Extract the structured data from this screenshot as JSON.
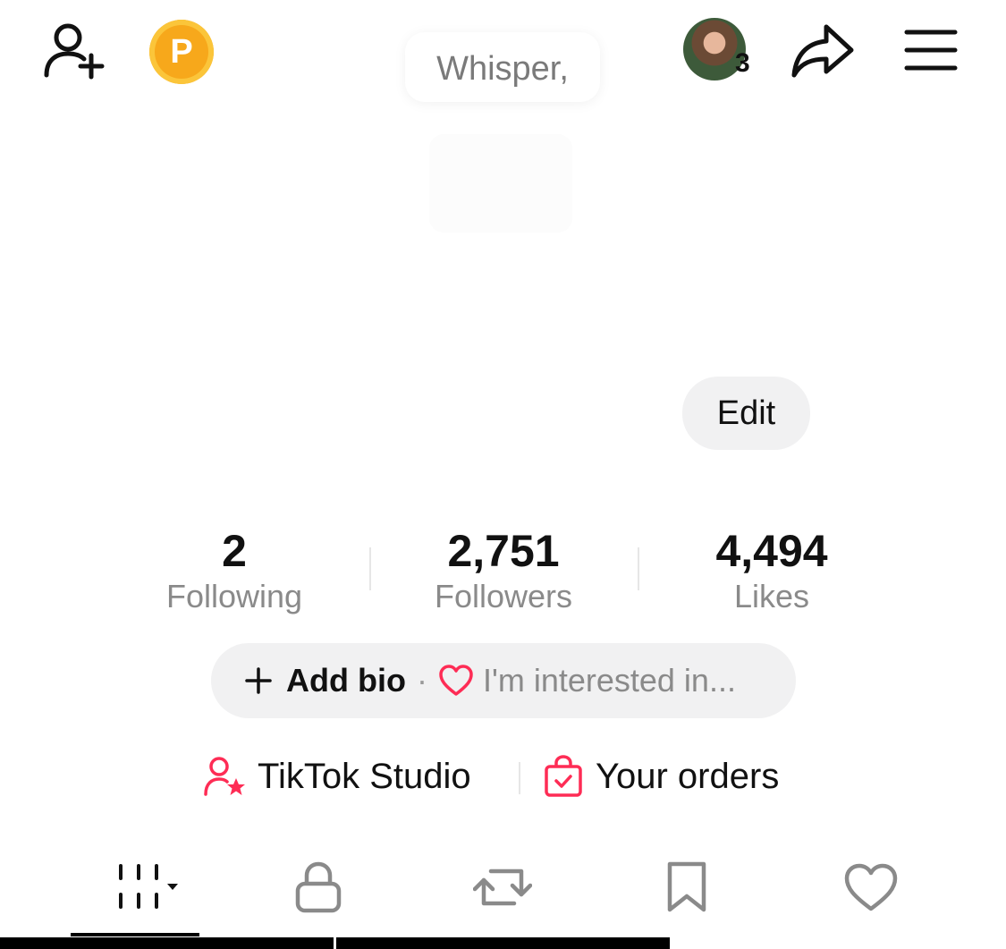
{
  "header": {
    "coin_letter": "P",
    "whisper_text": "Whisper,",
    "avatar_count": "3"
  },
  "profile": {
    "edit_label": "Edit"
  },
  "stats": [
    {
      "value": "2",
      "label": "Following"
    },
    {
      "value": "2,751",
      "label": "Followers"
    },
    {
      "value": "4,494",
      "label": "Likes"
    }
  ],
  "bio": {
    "add_label": "Add bio",
    "separator": "·",
    "interest_label": "I'm interested in..."
  },
  "links": {
    "studio_label": "TikTok Studio",
    "orders_label": "Your orders"
  },
  "tabs": [
    {
      "icon": "videos-grid-icon"
    },
    {
      "icon": "lock-icon"
    },
    {
      "icon": "repost-icon"
    },
    {
      "icon": "bookmark-icon"
    },
    {
      "icon": "heart-icon"
    }
  ],
  "colors": {
    "accent": "#fe2c55",
    "coin": "#f7a81b",
    "pill_bg": "#f1f1f2",
    "muted_text": "#8a8a8a"
  }
}
